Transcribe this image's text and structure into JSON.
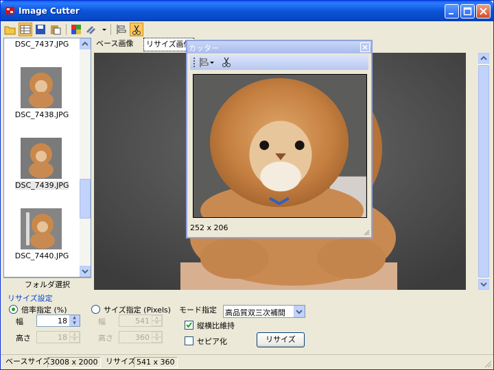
{
  "window": {
    "title": "Image Cutter"
  },
  "files": [
    {
      "name": "DSC_7437.JPG"
    },
    {
      "name": "DSC_7438.JPG"
    },
    {
      "name": "DSC_7439.JPG"
    },
    {
      "name": "DSC_7440.JPG"
    }
  ],
  "selected_file": "DSC_7439.JPG",
  "folder_button": "フォルダ選択",
  "tabs": [
    {
      "label": "ベース画像"
    },
    {
      "label": "リサイズ画像"
    }
  ],
  "active_tab": "リサイズ画像",
  "cutter": {
    "title": "カッター",
    "size_readout": "252 x 206"
  },
  "settings": {
    "group_title": "リサイズ設定",
    "ratio_mode_label": "倍率指定 (%)",
    "size_mode_label": "サイズ指定 (Pixels)",
    "ratio_selected": true,
    "width_label": "幅",
    "height_label": "高さ",
    "ratio_width": "18",
    "ratio_height": "18",
    "pixel_width": "541",
    "pixel_height": "360",
    "mode_label": "モード指定",
    "mode_value": "高品質双三次補間",
    "keep_aspect_label": "縦横比維持",
    "keep_aspect_checked": true,
    "sepia_label": "セピア化",
    "sepia_checked": false,
    "resize_button": "リサイズ"
  },
  "status": {
    "base_size_label": "ベースサイズ",
    "base_size_value": "3008 x 2000",
    "resize_label": "リサイズ",
    "resize_value": "541 x 360"
  },
  "colors": {
    "title_blue": "#0a55d8",
    "selection_highlight": "#ffc860",
    "group_title": "#0046d5"
  }
}
